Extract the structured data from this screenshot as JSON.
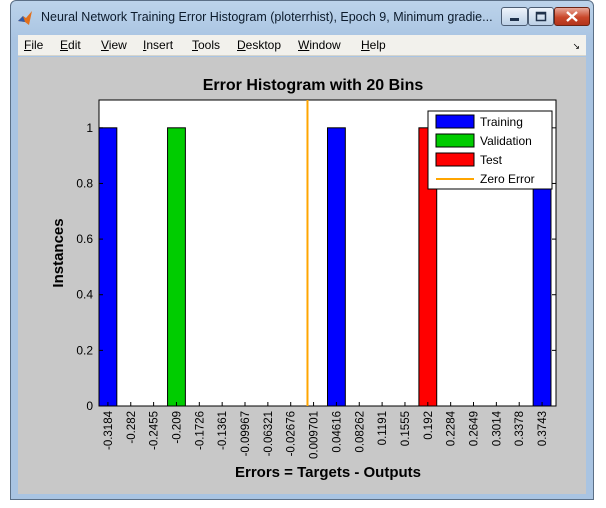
{
  "window": {
    "title": "Neural Network Training Error Histogram (ploterrhist), Epoch 9, Minimum gradie...",
    "controls": [
      "minimize",
      "maximize",
      "close"
    ]
  },
  "menu": [
    {
      "label": "File",
      "key": "F",
      "rest": "ile"
    },
    {
      "label": "Edit",
      "key": "E",
      "rest": "dit"
    },
    {
      "label": "View",
      "key": "V",
      "rest": "iew"
    },
    {
      "label": "Insert",
      "key": "I",
      "rest": "nsert"
    },
    {
      "label": "Tools",
      "key": "T",
      "rest": "ools"
    },
    {
      "label": "Desktop",
      "key": "D",
      "rest": "esktop"
    },
    {
      "label": "Window",
      "key": "W",
      "rest": "indow"
    },
    {
      "label": "Help",
      "key": "H",
      "rest": "elp"
    }
  ],
  "chart_data": {
    "type": "bar",
    "title": "Error Histogram with 20 Bins",
    "xlabel": "Errors = Targets - Outputs",
    "ylabel": "Instances",
    "ylim": [
      0,
      1.1
    ],
    "yticks": [
      "0",
      "0.2",
      "0.4",
      "0.6",
      "0.8",
      "1"
    ],
    "categories": [
      "-0.3184",
      "-0.282",
      "-0.2455",
      "-0.209",
      "-0.1726",
      "-0.1361",
      "-0.09967",
      "-0.06321",
      "-0.02676",
      "0.009701",
      "0.04616",
      "0.08262",
      "0.1191",
      "0.1555",
      "0.192",
      "0.2284",
      "0.2649",
      "0.3014",
      "0.3378",
      "0.3743"
    ],
    "series": [
      {
        "name": "Training",
        "color": "#0000ff",
        "values": [
          1,
          0,
          0,
          0,
          0,
          0,
          0,
          0,
          0,
          0,
          1,
          0,
          0,
          0,
          0,
          0,
          0,
          0,
          0,
          1
        ]
      },
      {
        "name": "Validation",
        "color": "#00cc00",
        "values": [
          0,
          0,
          0,
          1,
          0,
          0,
          0,
          0,
          0,
          0,
          0,
          0,
          0,
          0,
          0,
          0,
          0,
          0,
          0,
          0
        ]
      },
      {
        "name": "Test",
        "color": "#ff0000",
        "values": [
          0,
          0,
          0,
          0,
          0,
          0,
          0,
          0,
          0,
          0,
          0,
          0,
          0,
          0,
          1,
          0,
          0,
          0,
          0,
          0
        ]
      }
    ],
    "zero_error": {
      "name": "Zero Error",
      "color": "#ffa500",
      "x": 0
    },
    "legend": "top-right",
    "grid": false
  }
}
